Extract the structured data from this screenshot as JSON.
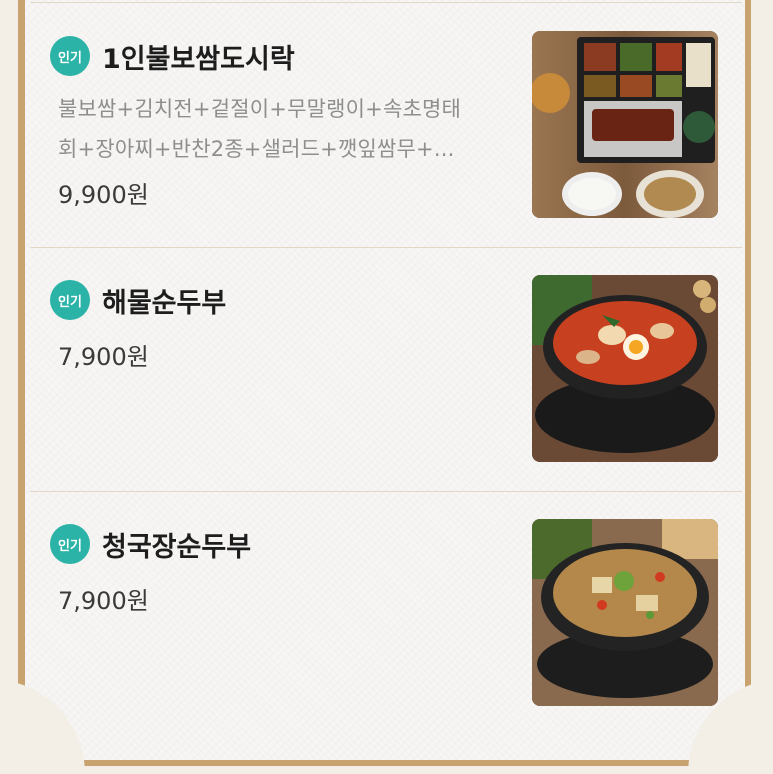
{
  "menu": [
    {
      "badge": "인기",
      "name": "1인불보쌈도시락",
      "desc_line1": "불보쌈+김치전+겉절이+무말랭이+속초명태",
      "desc_line2": "회+장아찌+반찬2종+샐러드+깻잎쌈무+...",
      "price": "9,900원",
      "image": "lunchbox-photo"
    },
    {
      "badge": "인기",
      "name": "해물순두부",
      "price": "7,900원",
      "image": "seafood-sundubu-photo"
    },
    {
      "badge": "인기",
      "name": "청국장순두부",
      "price": "7,900원",
      "image": "cheonggukjang-sundubu-photo"
    }
  ],
  "colors": {
    "badge": "#2bb3a8",
    "frame": "#c9a36f",
    "name_text": "#1d1d1d",
    "desc_text": "#8e8e8e",
    "price_text": "#3a3a3a"
  }
}
